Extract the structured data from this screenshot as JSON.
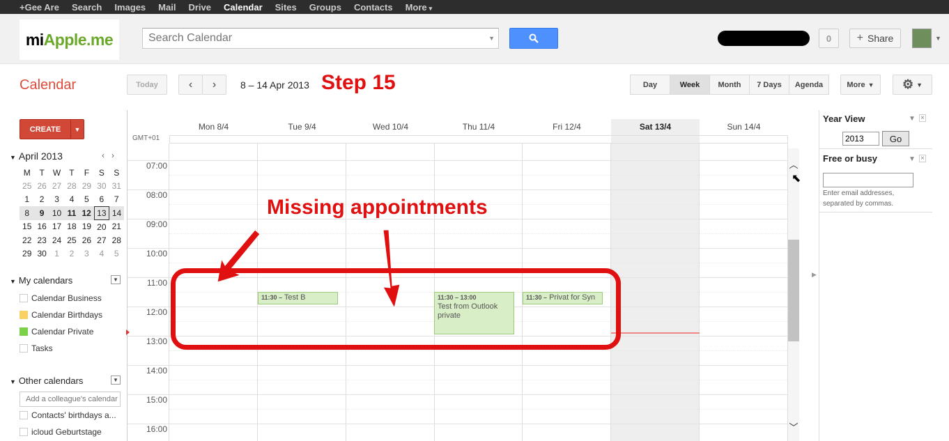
{
  "topbar": {
    "items": [
      "+Gee Are",
      "Search",
      "Images",
      "Mail",
      "Drive",
      "Calendar",
      "Sites",
      "Groups",
      "Contacts",
      "More"
    ],
    "active": "Calendar"
  },
  "header": {
    "logo": {
      "part1": "mi",
      "part2": "Apple",
      "part3": ".me"
    },
    "search_placeholder": "Search Calendar",
    "notifications": "0",
    "share_label": "Share"
  },
  "toolbar": {
    "app_title": "Calendar",
    "today": "Today",
    "prev": "‹",
    "next": "›",
    "date_range": "8 – 14 Apr 2013",
    "views": [
      "Day",
      "Week",
      "Month",
      "7 Days",
      "Agenda"
    ],
    "active_view": "Week",
    "more": "More"
  },
  "annotations": {
    "step": "Step 15",
    "missing": "Missing appointments"
  },
  "sidebar": {
    "create": "CREATE",
    "mini_month": "April 2013",
    "weekday_initials": [
      "M",
      "T",
      "W",
      "T",
      "F",
      "S",
      "S"
    ],
    "weeks": [
      [
        "25",
        "26",
        "27",
        "28",
        "29",
        "30",
        "31"
      ],
      [
        "1",
        "2",
        "3",
        "4",
        "5",
        "6",
        "7"
      ],
      [
        "8",
        "9",
        "10",
        "11",
        "12",
        "13",
        "14"
      ],
      [
        "15",
        "16",
        "17",
        "18",
        "19",
        "20",
        "21"
      ],
      [
        "22",
        "23",
        "24",
        "25",
        "26",
        "27",
        "28"
      ],
      [
        "29",
        "30",
        "1",
        "2",
        "3",
        "4",
        "5"
      ]
    ],
    "my_calendars_title": "My calendars",
    "my_calendars": [
      {
        "label": "Calendar Business",
        "color": "#ffffff"
      },
      {
        "label": "Calendar Birthdays",
        "color": "#fad165"
      },
      {
        "label": "Calendar Private",
        "color": "#7bd148"
      },
      {
        "label": "Tasks",
        "color": "#ffffff"
      }
    ],
    "other_calendars_title": "Other calendars",
    "colleague_placeholder": "Add a colleague's calendar",
    "other_calendars": [
      {
        "label": "Contacts' birthdays a..."
      },
      {
        "label": "icloud Geburtstage"
      }
    ]
  },
  "grid": {
    "timezone": "GMT+01",
    "days": [
      "Mon 8/4",
      "Tue 9/4",
      "Wed 10/4",
      "Thu 11/4",
      "Fri 12/4",
      "Sat 13/4",
      "Sun 14/4"
    ],
    "hours": [
      "07:00",
      "08:00",
      "09:00",
      "10:00",
      "11:00",
      "12:00",
      "13:00",
      "14:00",
      "15:00",
      "16:00"
    ],
    "events": [
      {
        "time": "11:30 –",
        "title": "Test B"
      },
      {
        "time": "11:30 – 13:00",
        "title": "Test from Outlook private"
      },
      {
        "time": "11:30 –",
        "title": "Privat for Syn"
      }
    ]
  },
  "right_pane": {
    "year_view_title": "Year View",
    "year_value": "2013",
    "go": "Go",
    "free_busy_title": "Free or busy",
    "hint": "Enter email addresses, separated by commas."
  },
  "colors": {
    "accent_red": "#dd4b39",
    "annotation_red": "#e01010",
    "event_green": "#d8eec6"
  }
}
